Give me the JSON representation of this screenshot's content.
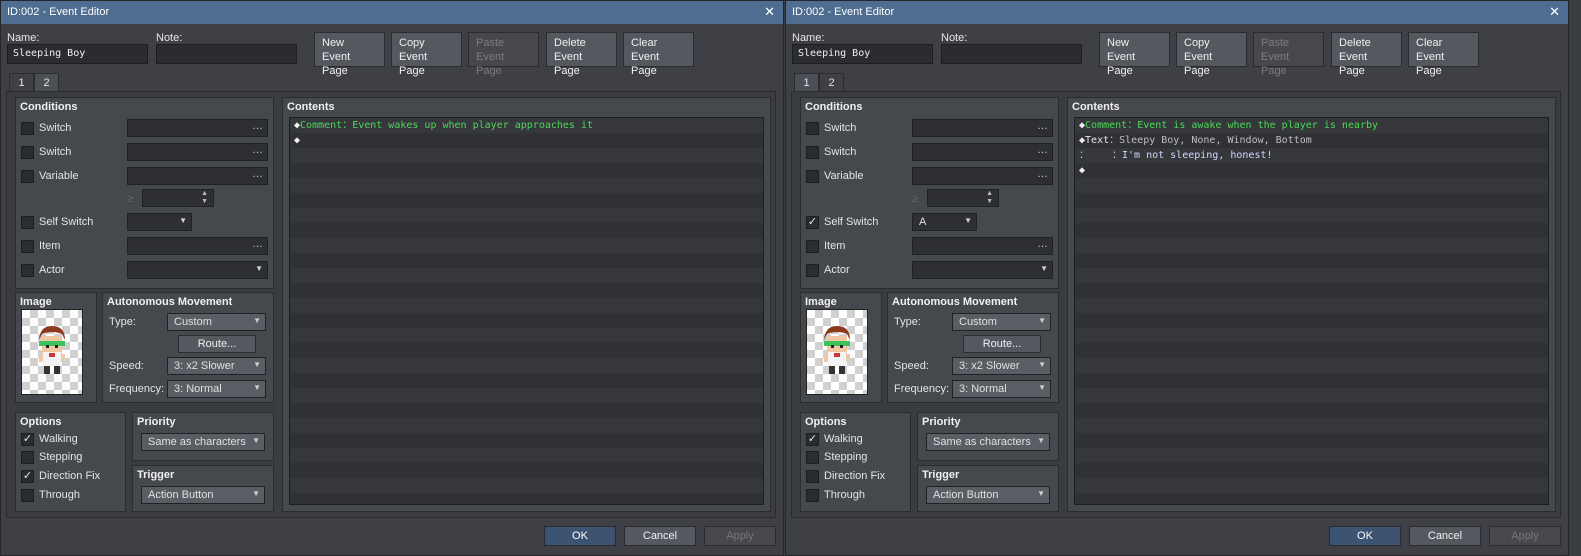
{
  "windows": [
    {
      "title": "ID:002 - Event Editor",
      "name_label": "Name:",
      "name_value": "Sleeping Boy",
      "note_label": "Note:",
      "note_value": "",
      "buttons": {
        "new": [
          "New",
          "Event Page"
        ],
        "copy": [
          "Copy",
          "Event Page"
        ],
        "paste": [
          "Paste",
          "Event Page"
        ],
        "delete": [
          "Delete",
          "Event Page"
        ],
        "clear": [
          "Clear",
          "Event Page"
        ]
      },
      "tabs": [
        "1",
        "2"
      ],
      "active_tab": 0,
      "conditions": {
        "title": "Conditions",
        "switch1": {
          "label": "Switch",
          "checked": false,
          "value": ""
        },
        "switch2": {
          "label": "Switch",
          "checked": false,
          "value": ""
        },
        "variable": {
          "label": "Variable",
          "checked": false,
          "value": ""
        },
        "ge": "≥",
        "self_switch": {
          "label": "Self Switch",
          "checked": false,
          "value": ""
        },
        "item": {
          "label": "Item",
          "checked": false,
          "value": ""
        },
        "actor": {
          "label": "Actor",
          "checked": false,
          "value": ""
        }
      },
      "image_title": "Image",
      "movement": {
        "title": "Autonomous Movement",
        "type_label": "Type:",
        "type_value": "Custom",
        "route_label": "Route...",
        "speed_label": "Speed:",
        "speed_value": "3: x2 Slower",
        "freq_label": "Frequency:",
        "freq_value": "3: Normal"
      },
      "options": {
        "title": "Options",
        "walking": {
          "label": "Walking",
          "checked": true
        },
        "stepping": {
          "label": "Stepping",
          "checked": false
        },
        "direction_fix": {
          "label": "Direction Fix",
          "checked": true
        },
        "through": {
          "label": "Through",
          "checked": false
        }
      },
      "priority": {
        "title": "Priority",
        "value": "Same as characters"
      },
      "trigger": {
        "title": "Trigger",
        "value": "Action Button"
      },
      "contents": {
        "title": "Contents",
        "rows": [
          {
            "marker": "◆",
            "cmd": "Comment",
            "sep": "：",
            "text": "Event wakes up when player approaches it",
            "kind": "green"
          },
          {
            "marker": "◆",
            "cmd": "",
            "sep": "",
            "text": "",
            "kind": "white"
          }
        ]
      },
      "footer": {
        "ok": "OK",
        "cancel": "Cancel",
        "apply": "Apply"
      }
    },
    {
      "title": "ID:002 - Event Editor",
      "name_label": "Name:",
      "name_value": "Sleeping Boy",
      "note_label": "Note:",
      "note_value": "",
      "buttons": {
        "new": [
          "New",
          "Event Page"
        ],
        "copy": [
          "Copy",
          "Event Page"
        ],
        "paste": [
          "Paste",
          "Event Page"
        ],
        "delete": [
          "Delete",
          "Event Page"
        ],
        "clear": [
          "Clear",
          "Event Page"
        ]
      },
      "tabs": [
        "1",
        "2"
      ],
      "active_tab": 1,
      "conditions": {
        "title": "Conditions",
        "switch1": {
          "label": "Switch",
          "checked": false,
          "value": ""
        },
        "switch2": {
          "label": "Switch",
          "checked": false,
          "value": ""
        },
        "variable": {
          "label": "Variable",
          "checked": false,
          "value": ""
        },
        "ge": "≥",
        "self_switch": {
          "label": "Self Switch",
          "checked": true,
          "value": "A"
        },
        "item": {
          "label": "Item",
          "checked": false,
          "value": ""
        },
        "actor": {
          "label": "Actor",
          "checked": false,
          "value": ""
        }
      },
      "image_title": "Image",
      "movement": {
        "title": "Autonomous Movement",
        "type_label": "Type:",
        "type_value": "Custom",
        "route_label": "Route...",
        "speed_label": "Speed:",
        "speed_value": "3: x2 Slower",
        "freq_label": "Frequency:",
        "freq_value": "3: Normal"
      },
      "options": {
        "title": "Options",
        "walking": {
          "label": "Walking",
          "checked": true
        },
        "stepping": {
          "label": "Stepping",
          "checked": false
        },
        "direction_fix": {
          "label": "Direction Fix",
          "checked": false
        },
        "through": {
          "label": "Through",
          "checked": false
        }
      },
      "priority": {
        "title": "Priority",
        "value": "Same as characters"
      },
      "trigger": {
        "title": "Trigger",
        "value": "Action Button"
      },
      "contents": {
        "title": "Contents",
        "rows": [
          {
            "marker": "◆",
            "cmd": "Comment",
            "sep": "：",
            "text": "Event is awake when the player is nearby",
            "kind": "green"
          },
          {
            "marker": "◆",
            "cmd": "Text",
            "sep": "：",
            "text": "Sleepy Boy, None, Window, Bottom",
            "kind": "text"
          },
          {
            "marker": "：",
            "cmd": "",
            "sep": "：",
            "text": "I'm not sleeping, honest!",
            "kind": "cont"
          },
          {
            "marker": "◆",
            "cmd": "",
            "sep": "",
            "text": "",
            "kind": "white"
          }
        ]
      },
      "footer": {
        "ok": "OK",
        "cancel": "Cancel",
        "apply": "Apply"
      }
    }
  ],
  "colors": {
    "titlebar": "#4f6d90",
    "comment": "#4cd85a",
    "ok_button": "#3d5372"
  },
  "icons": [
    "close-icon",
    "dropdown-arrow-icon",
    "ellipsis-icon",
    "check-icon",
    "diamond-marker-icon",
    "spinner-arrows-icon"
  ]
}
